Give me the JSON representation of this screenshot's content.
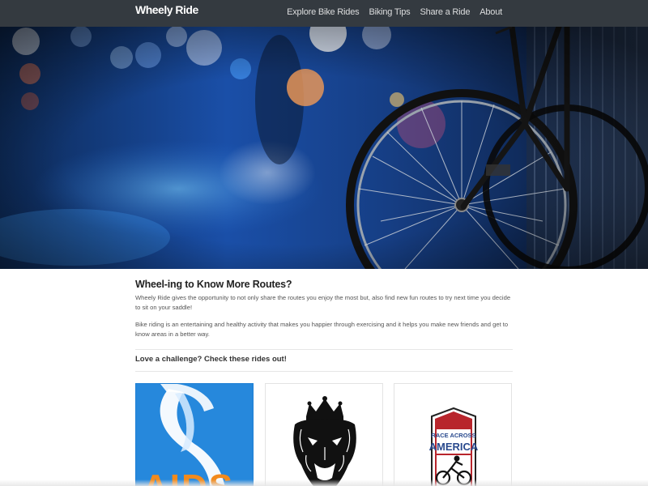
{
  "navbar": {
    "brand": "Wheely Ride",
    "links": [
      "Explore Bike Rides",
      "Biking Tips",
      "Share a Ride",
      "About"
    ]
  },
  "colors": {
    "navbar_bg": "#343a40",
    "hero_blue": "#1a4fa8",
    "card_blue": "#1e7fd4",
    "race_red": "#b8252c",
    "race_blue": "#2a4a8e"
  },
  "intro": {
    "heading": "Wheel-ing to Know More Routes?",
    "paragraph1": "Wheely Ride gives the opportunity to not only share the routes you enjoy the most but, also find new fun routes to try next time you decide to sit on your saddle!",
    "paragraph2": "Bike riding is an entertaining and healthy activity that makes you happier through exercising and it helps you make new friends and get to know areas in a better way."
  },
  "challenge": {
    "heading": "Love a challenge? Check these rides out!"
  },
  "cards": [
    {
      "logo": "aids-ribbon-logo",
      "visible_text": "AIDS"
    },
    {
      "logo": "lion-crest-logo",
      "visible_text": ""
    },
    {
      "logo": "race-across-america-logo",
      "visible_text": "RACE ACROSS AMERICA"
    }
  ]
}
